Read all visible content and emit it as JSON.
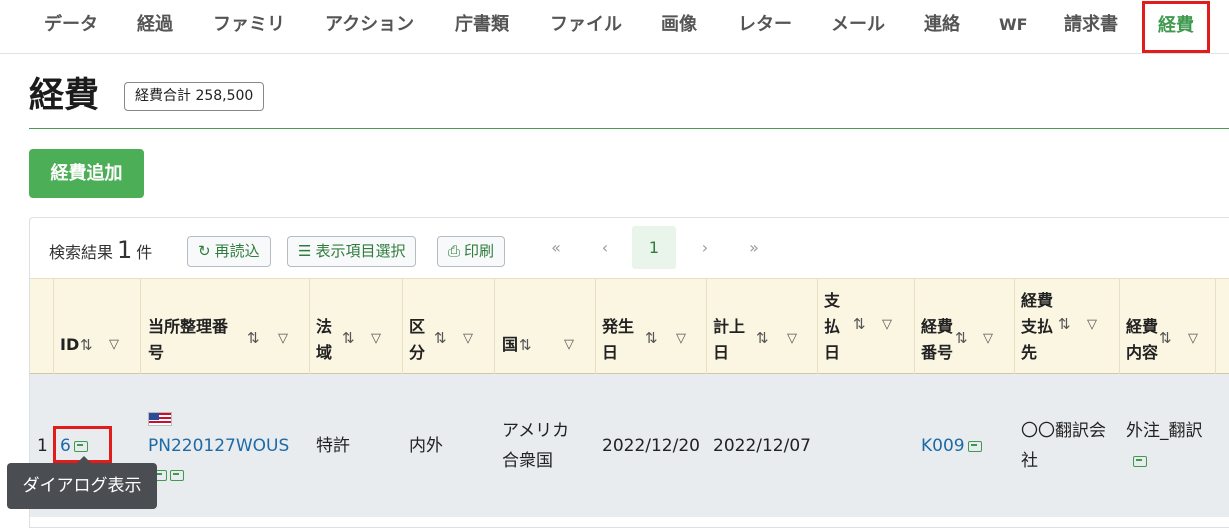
{
  "tabs": [
    {
      "label": "データ"
    },
    {
      "label": "経過"
    },
    {
      "label": "ファミリ"
    },
    {
      "label": "アクション"
    },
    {
      "label": "庁書類"
    },
    {
      "label": "ファイル"
    },
    {
      "label": "画像"
    },
    {
      "label": "レター"
    },
    {
      "label": "メール"
    },
    {
      "label": "連絡"
    },
    {
      "label": "WF"
    },
    {
      "label": "請求書"
    },
    {
      "label": "経費",
      "active": true
    }
  ],
  "page": {
    "title": "経費",
    "total_badge": "経費合計 258,500",
    "add_button": "経費追加"
  },
  "results": {
    "label_prefix": "検索結果",
    "count": "1",
    "label_suffix": "件",
    "reload_button": "再読込",
    "columns_button": "表示項目選択",
    "print_button": "印刷"
  },
  "pagination": {
    "first": "«",
    "prev": "‹",
    "current": "1",
    "next": "›",
    "last": "»"
  },
  "table": {
    "headers": {
      "id": "ID",
      "ref_line1": "当所整理番",
      "ref_line2": "号",
      "law_line1": "法",
      "law_line2": "域",
      "type_line1": "区",
      "type_line2": "分",
      "country": "国",
      "issue_line1": "発生",
      "issue_line2": "日",
      "record_line1": "計上",
      "record_line2": "日",
      "pay_line1": "支",
      "pay_line2": "払",
      "pay_line3": "日",
      "expno_line1": "経費",
      "expno_line2": "番号",
      "payee_line1": "経費",
      "payee_line2": "支払",
      "payee_line3": "先",
      "content_line1": "経費",
      "content_line2": "内容"
    },
    "row": {
      "index": "1",
      "id": "6",
      "ref_no": "PN220127WOUS",
      "law": "特許",
      "type": "内外",
      "country_line1": "アメリカ",
      "country_line2": "合衆国",
      "issue_date": "2022/12/20",
      "record_date": "2022/12/07",
      "expense_no": "K009",
      "payee_line1": "〇〇翻訳会",
      "payee_line2": "社",
      "content": "外注_翻訳"
    }
  },
  "tooltip": "ダイアログ表示",
  "colors": {
    "accent_green": "#4cae57",
    "highlight_red": "#e21b1b",
    "header_bg": "#fbf6e2",
    "link_blue": "#1d6aa7"
  }
}
